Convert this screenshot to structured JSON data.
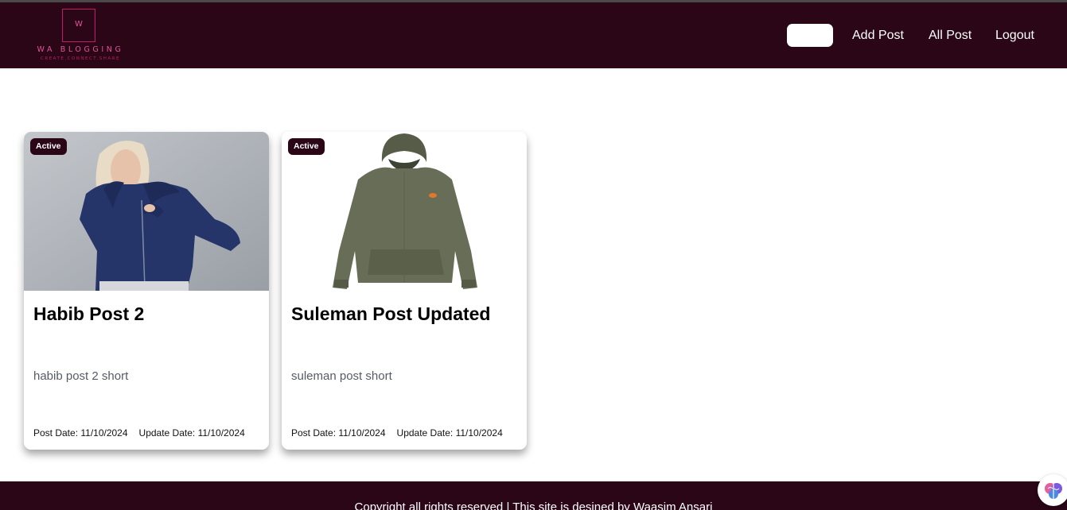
{
  "navbar": {
    "logo": {
      "letter": "W",
      "name": "WA BLOGGING",
      "tagline": "CREATE.CONNECT.SHARE"
    },
    "links": [
      {
        "label": "Add Post"
      },
      {
        "label": "All Post"
      },
      {
        "label": "Logout"
      }
    ],
    "colors": {
      "background": "#2a0616",
      "logo_accent": "#e0549b"
    }
  },
  "posts": [
    {
      "badge": "Active",
      "title": "Habib Post 2",
      "short": "habib post 2 short",
      "post_date": "Post Date: 11/10/2024",
      "update_date": "Update Date: 11/10/2024",
      "image": "woman-in-navy-zip-hoodie-photo"
    },
    {
      "badge": "Active",
      "title": "Suleman Post Updated",
      "short": "suleman post short",
      "post_date": "Post Date: 11/10/2024",
      "update_date": "Update Date: 11/10/2024",
      "image": "olive-green-hoodie-photo"
    }
  ],
  "footer": {
    "text": "Copyright all rights reserved | This site is desined by Waasim Ansari"
  },
  "floating_widget": {
    "icon": "brain-icon"
  }
}
